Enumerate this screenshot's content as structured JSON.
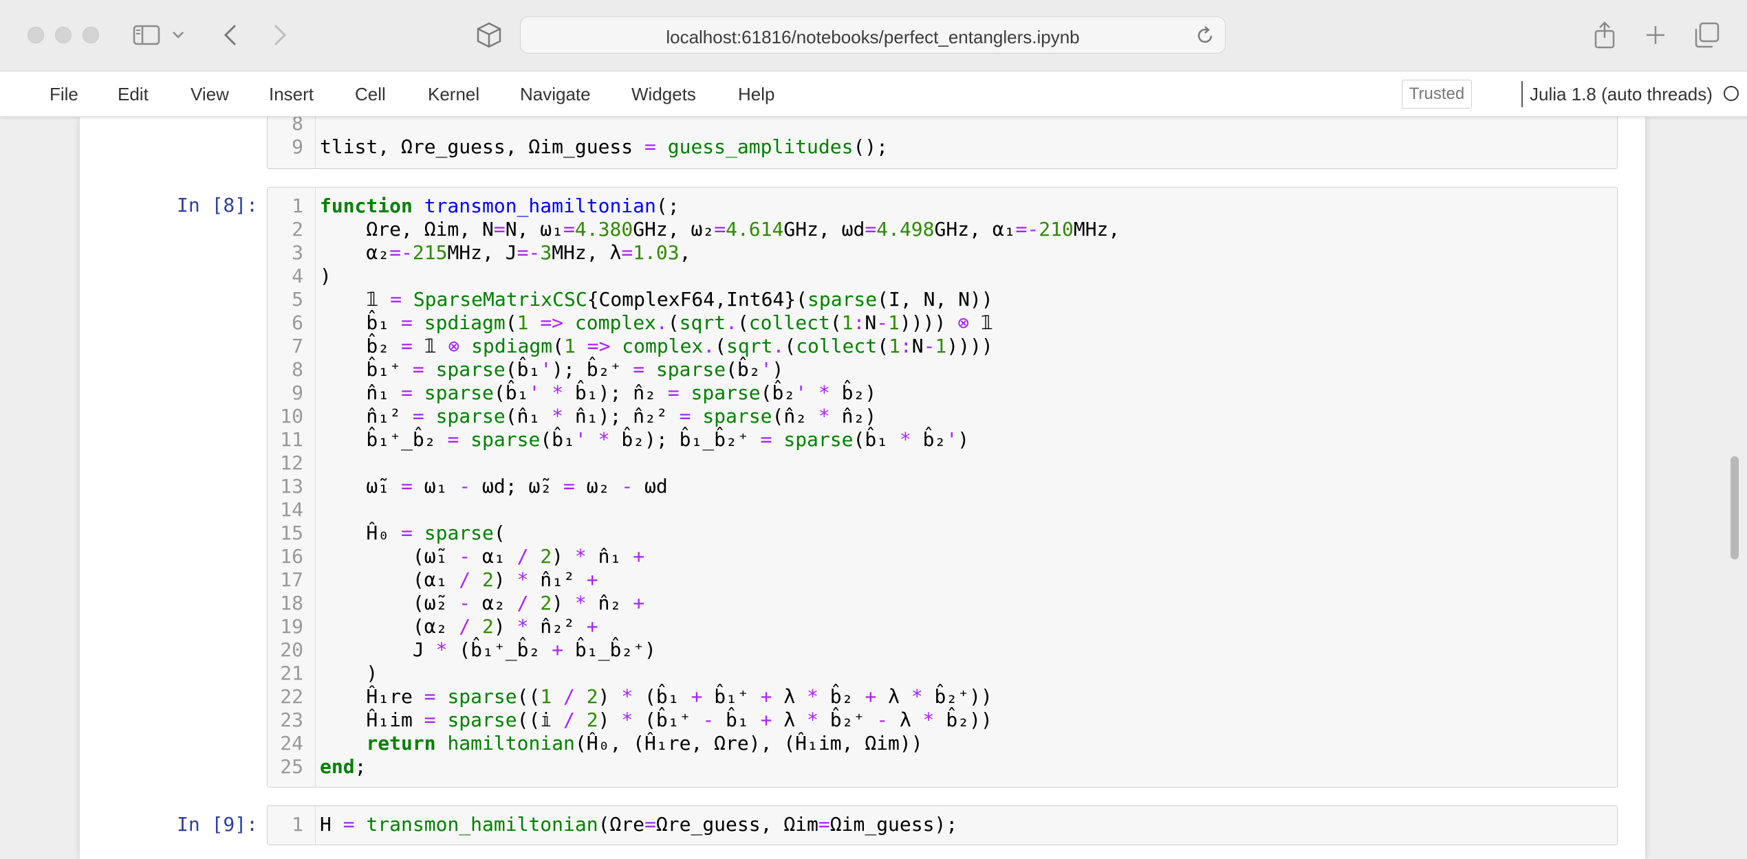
{
  "browser": {
    "url": "localhost:61816/notebooks/perfect_entanglers.ipynb"
  },
  "menubar": {
    "items": [
      "File",
      "Edit",
      "View",
      "Insert",
      "Cell",
      "Kernel",
      "Navigate",
      "Widgets",
      "Help"
    ],
    "trusted_label": "Trusted",
    "kernel_label": "Julia 1.8 (auto threads)"
  },
  "cells": [
    {
      "prompt": "",
      "lines": [
        {
          "n": "8",
          "text": ""
        },
        {
          "n": "9",
          "text": "tlist, Ωre_guess, Ωim_guess = guess_amplitudes();"
        }
      ]
    },
    {
      "prompt": "In [8]:",
      "lines": [
        {
          "n": "1",
          "text": "function transmon_hamiltonian(;"
        },
        {
          "n": "2",
          "text": "    Ωre, Ωim, N=N, ω₁=4.380GHz, ω₂=4.614GHz, ωd=4.498GHz, α₁=-210MHz,"
        },
        {
          "n": "3",
          "text": "    α₂=-215MHz, J=-3MHz, λ=1.03,"
        },
        {
          "n": "4",
          "text": ")"
        },
        {
          "n": "5",
          "text": "    𝟙 = SparseMatrixCSC{ComplexF64,Int64}(sparse(I, N, N))"
        },
        {
          "n": "6",
          "text": "    b̂₁ = spdiagm(1 => complex.(sqrt.(collect(1:N-1)))) ⊗ 𝟙"
        },
        {
          "n": "7",
          "text": "    b̂₂ = 𝟙 ⊗ spdiagm(1 => complex.(sqrt.(collect(1:N-1))))"
        },
        {
          "n": "8",
          "text": "    b̂₁⁺ = sparse(b̂₁'); b̂₂⁺ = sparse(b̂₂')"
        },
        {
          "n": "9",
          "text": "    n̂₁ = sparse(b̂₁' * b̂₁); n̂₂ = sparse(b̂₂' * b̂₂)"
        },
        {
          "n": "10",
          "text": "    n̂₁² = sparse(n̂₁ * n̂₁); n̂₂² = sparse(n̂₂ * n̂₂)"
        },
        {
          "n": "11",
          "text": "    b̂₁⁺_b̂₂ = sparse(b̂₁' * b̂₂); b̂₁_b̂₂⁺ = sparse(b̂₁ * b̂₂')"
        },
        {
          "n": "12",
          "text": ""
        },
        {
          "n": "13",
          "text": "    ω̃₁ = ω₁ - ωd; ω̃₂ = ω₂ - ωd"
        },
        {
          "n": "14",
          "text": ""
        },
        {
          "n": "15",
          "text": "    Ĥ₀ = sparse("
        },
        {
          "n": "16",
          "text": "        (ω̃₁ - α₁ / 2) * n̂₁ +"
        },
        {
          "n": "17",
          "text": "        (α₁ / 2) * n̂₁² +"
        },
        {
          "n": "18",
          "text": "        (ω̃₂ - α₂ / 2) * n̂₂ +"
        },
        {
          "n": "19",
          "text": "        (α₂ / 2) * n̂₂² +"
        },
        {
          "n": "20",
          "text": "        J * (b̂₁⁺_b̂₂ + b̂₁_b̂₂⁺)"
        },
        {
          "n": "21",
          "text": "    )"
        },
        {
          "n": "22",
          "text": "    Ĥ₁re = sparse((1 / 2) * (b̂₁ + b̂₁⁺ + λ * b̂₂ + λ * b̂₂⁺))"
        },
        {
          "n": "23",
          "text": "    Ĥ₁im = sparse((𝕚 / 2) * (b̂₁⁺ - b̂₁ + λ * b̂₂⁺ - λ * b̂₂))"
        },
        {
          "n": "24",
          "text": "    return hamiltonian(Ĥ₀, (Ĥ₁re, Ωre), (Ĥ₁im, Ωim))"
        },
        {
          "n": "25",
          "text": "end;"
        }
      ]
    },
    {
      "prompt": "In [9]:",
      "lines": [
        {
          "n": "1",
          "text": "H = transmon_hamiltonian(Ωre=Ωre_guess, Ωim=Ωim_guess);"
        }
      ]
    }
  ],
  "colors": {
    "keyword": "#008000",
    "function": "#0000ff",
    "number": "#2e8b00",
    "operator": "#aa22ff",
    "prompt": "#303f9f"
  }
}
